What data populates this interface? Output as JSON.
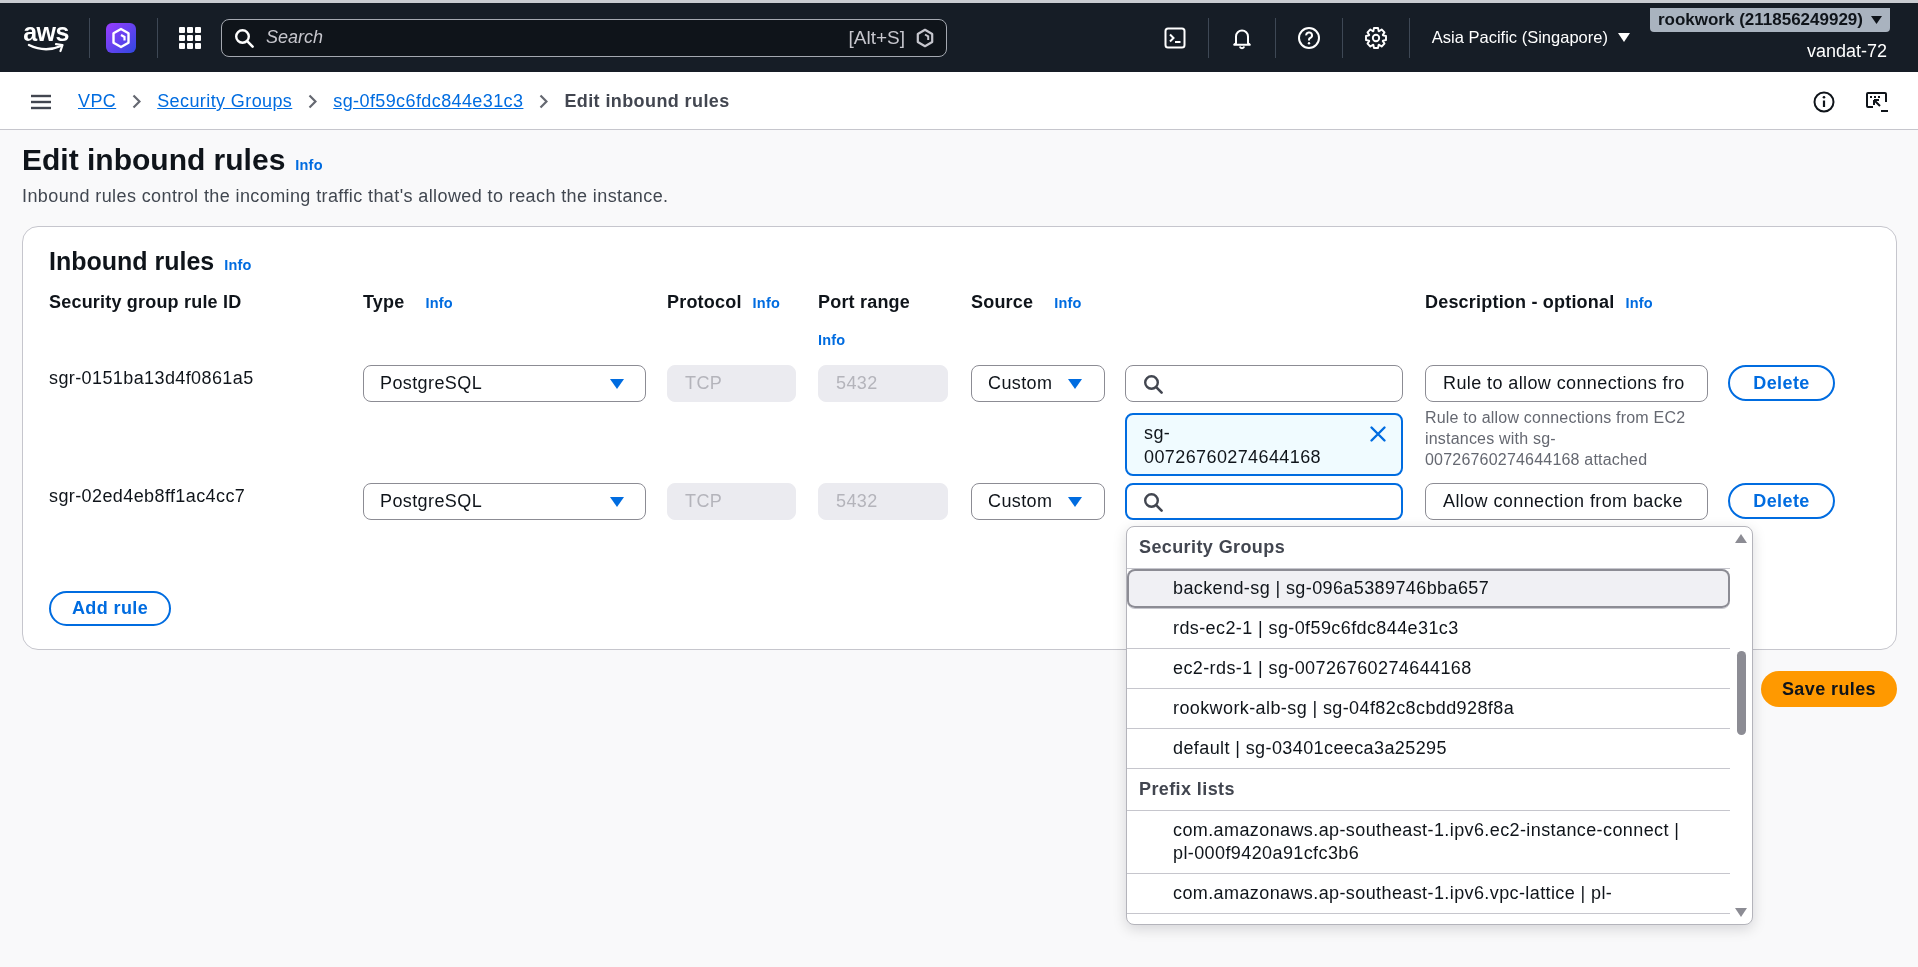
{
  "top_nav": {
    "logo": "aws",
    "search": {
      "placeholder": "Search",
      "shortcut": "[Alt+S]"
    },
    "region": "Asia Pacific (Singapore)",
    "account": "rookwork (211856249929)",
    "user": "vandat-72"
  },
  "breadcrumbs": [
    {
      "label": "VPC",
      "kind": "link"
    },
    {
      "label": "Security Groups",
      "kind": "link"
    },
    {
      "label": "sg-0f59c6fdc844e31c3",
      "kind": "link"
    },
    {
      "label": "Edit inbound rules",
      "kind": "current"
    }
  ],
  "header": {
    "title": "Edit inbound rules",
    "info": "Info",
    "description": "Inbound rules control the incoming traffic that's allowed to reach the instance."
  },
  "inbound_rules": {
    "title": "Inbound rules",
    "info": "Info",
    "columns": [
      {
        "label": "Security group rule ID"
      },
      {
        "label": "Type",
        "info": "Info"
      },
      {
        "label": "Protocol",
        "info": "Info"
      },
      {
        "label": "Port range",
        "info": "Info"
      },
      {
        "label": "Source",
        "info": "Info"
      },
      {
        "label": "Description - optional",
        "info": "Info"
      }
    ],
    "rows": [
      {
        "rule_id": "sgr-0151ba13d4f0861a5",
        "type": "PostgreSQL",
        "protocol": {
          "value": "TCP",
          "disabled": true
        },
        "port_range": {
          "value": "5432",
          "disabled": true
        },
        "source": "Custom",
        "source_search": {
          "focused": false
        },
        "source_tokens": [
          {
            "label": "sg-00726760274644168"
          }
        ],
        "description": "Rule to allow connections fro",
        "description_hint": "Rule to allow connections from EC2 instances with sg-00726760274644168 attached",
        "delete": "Delete"
      },
      {
        "rule_id": "sgr-02ed4eb8ff1ac4cc7",
        "type": "PostgreSQL",
        "protocol": {
          "value": "TCP",
          "disabled": true
        },
        "port_range": {
          "value": "5432",
          "disabled": true
        },
        "source": "Custom",
        "source_search": {
          "focused": true,
          "menu": {
            "groups": [
              {
                "label": "Security Groups",
                "options": [
                  {
                    "label": "backend-sg | sg-096a5389746bba657",
                    "selected": true
                  },
                  {
                    "label": "rds-ec2-1 | sg-0f59c6fdc844e31c3",
                    "selected": false
                  },
                  {
                    "label": "ec2-rds-1 | sg-00726760274644168",
                    "selected": false
                  },
                  {
                    "label": "rookwork-alb-sg | sg-04f82c8cbdd928f8a",
                    "selected": false
                  },
                  {
                    "label": "default | sg-03401ceeca3a25295",
                    "selected": false
                  }
                ]
              },
              {
                "label": "Prefix lists",
                "options": [
                  {
                    "label": "com.amazonaws.ap-southeast-1.ipv6.ec2-instance-connect | pl-000f9420a91cfc3b6",
                    "selected": false
                  },
                  {
                    "label": "com.amazonaws.ap-southeast-1.ipv6.vpc-lattice | pl-",
                    "selected": false
                  }
                ]
              }
            ]
          }
        },
        "description": "Allow connection from backe",
        "delete": "Delete"
      }
    ],
    "add_rule": "Add rule"
  },
  "actions": {
    "save": "Save rules"
  }
}
